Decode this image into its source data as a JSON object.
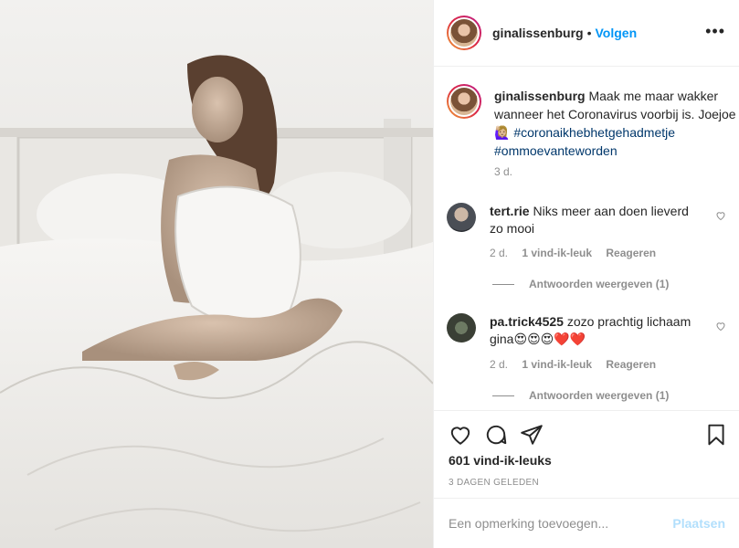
{
  "post": {
    "username": "ginalissenburg",
    "separator": "•",
    "follow_label": "Volgen",
    "more_icon": "•••"
  },
  "caption": {
    "username": "ginalissenburg",
    "text": "Maak me maar wakker wanneer het Coronavirus voorbij is. Joejoe 🙋🏼‍♀️",
    "hashtags": [
      "#coronaikhebhetgehadmetje",
      "#ommoevanteworden"
    ],
    "time": "3 d."
  },
  "comments": [
    {
      "username": "tert.rie",
      "text": "Niks meer aan doen lieverd zo mooi",
      "time": "2 d.",
      "likes": "1 vind-ik-leuk",
      "reply_label": "Reageren",
      "view_replies": "Antwoorden weergeven (1)"
    },
    {
      "username": "pa.trick4525",
      "text": "zozo prachtig lichaam gina😍😍😍❤️❤️",
      "time": "2 d.",
      "likes": "1 vind-ik-leuk",
      "reply_label": "Reageren",
      "view_replies": "Antwoorden weergeven (1)"
    }
  ],
  "actions": {
    "likes": "601 vind-ik-leuks",
    "date": "3 DAGEN GELEDEN"
  },
  "add_comment": {
    "placeholder": "Een opmerking toevoegen...",
    "post_label": "Plaatsen"
  },
  "colors": {
    "accent": "#0095f6",
    "hashtag": "#00376b",
    "muted": "#8e8e8e",
    "post_disabled": "#b2dffc"
  }
}
